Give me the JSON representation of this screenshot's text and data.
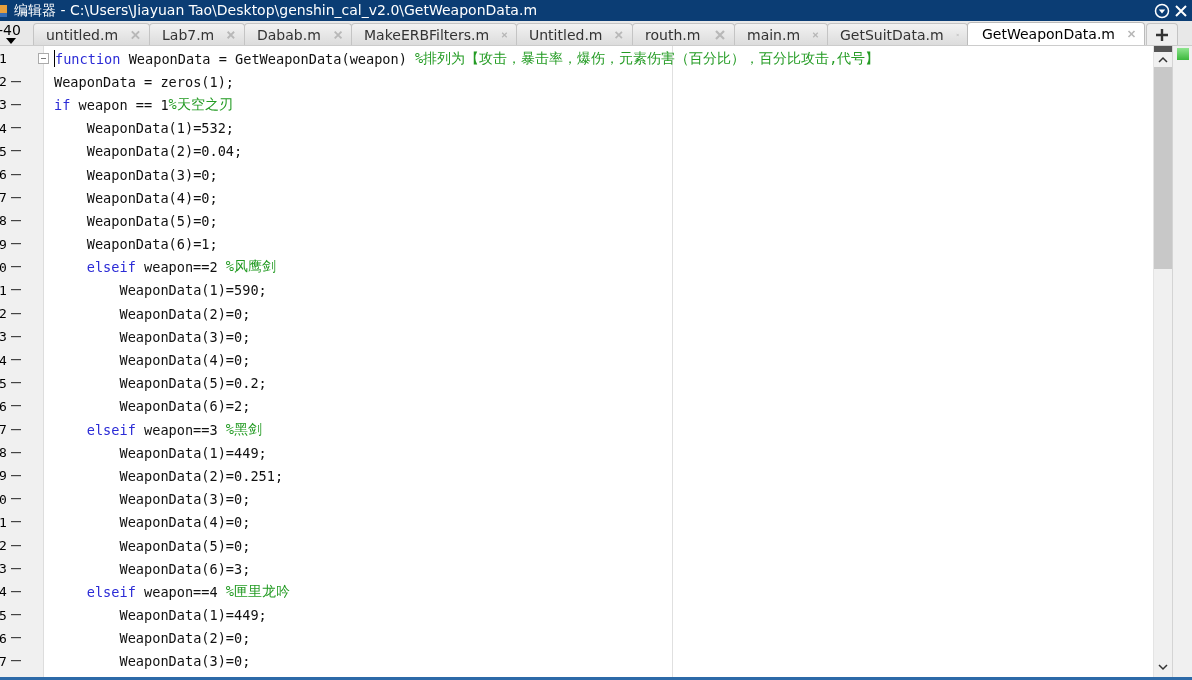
{
  "window": {
    "title": "编辑器 - C:\\Users\\Jiayuan Tao\\Desktop\\genshin_cal_v2.0\\GetWeaponData.m"
  },
  "tab_overflow": {
    "label": "-40"
  },
  "tabs": [
    {
      "label": "untitled.m",
      "selected": false
    },
    {
      "label": "Lab7.m",
      "selected": false
    },
    {
      "label": "Dabab.m",
      "selected": false
    },
    {
      "label": "MakeERBFilters.m",
      "selected": false
    },
    {
      "label": "Untitled.m",
      "selected": false
    },
    {
      "label": "routh.m",
      "selected": false
    },
    {
      "label": "main.m",
      "selected": false
    },
    {
      "label": "GetSuitData.m",
      "selected": false
    },
    {
      "label": "GetWeaponData.m",
      "selected": true
    }
  ],
  "lines": [
    {
      "number": "1",
      "executable": false,
      "foldable": true,
      "tokens": [
        {
          "kind": "keyword",
          "text": "function"
        },
        {
          "kind": "plain",
          "text": "WeaponData = GetWeaponData(weapon)"
        },
        {
          "kind": "comment",
          "text": "%排列为【攻击，暴击率，爆伤，元素伤害（百分比），百分比攻击,代号】"
        }
      ]
    },
    {
      "number": "2",
      "executable": true,
      "foldable": false,
      "tokens": [
        {
          "kind": "plain",
          "text": "WeaponData = zeros(1);"
        }
      ]
    },
    {
      "number": "3",
      "executable": true,
      "foldable": false,
      "tokens": [
        {
          "kind": "keyword",
          "text": "if"
        },
        {
          "kind": "plain",
          "text": "weapon == 1"
        },
        {
          "kind": "comment",
          "text": "%天空之刃"
        }
      ],
      "children": [
        {
          "number": "4",
          "executable": true,
          "foldable": false,
          "tokens": [
            {
              "kind": "plain",
              "text": "WeaponData(1)=532;"
            }
          ]
        },
        {
          "number": "5",
          "executable": true,
          "foldable": false,
          "tokens": [
            {
              "kind": "plain",
              "text": "WeaponData(2)=0.04;"
            }
          ]
        },
        {
          "number": "6",
          "executable": true,
          "foldable": false,
          "tokens": [
            {
              "kind": "plain",
              "text": "WeaponData(3)=0;"
            }
          ]
        },
        {
          "number": "7",
          "executable": true,
          "foldable": false,
          "tokens": [
            {
              "kind": "plain",
              "text": "WeaponData(4)=0;"
            }
          ]
        },
        {
          "number": "8",
          "executable": true,
          "foldable": false,
          "tokens": [
            {
              "kind": "plain",
              "text": "WeaponData(5)=0;"
            }
          ]
        },
        {
          "number": "9",
          "executable": true,
          "foldable": false,
          "tokens": [
            {
              "kind": "plain",
              "text": "WeaponData(6)=1;"
            }
          ]
        },
        {
          "number": "0",
          "executable": true,
          "foldable": false,
          "tokens": [
            {
              "kind": "keyword",
              "text": "elseif"
            },
            {
              "kind": "plain",
              "text": "weapon==2"
            },
            {
              "kind": "comment",
              "text": "%风鹰剑"
            }
          ],
          "children": [
            {
              "number": "1",
              "executable": true,
              "foldable": false,
              "tokens": [
                {
                  "kind": "plain",
                  "text": "WeaponData(1)=590;"
                }
              ]
            },
            {
              "number": "2",
              "executable": true,
              "foldable": false,
              "tokens": [
                {
                  "kind": "plain",
                  "text": "WeaponData(2)=0;"
                }
              ]
            },
            {
              "number": "3",
              "executable": true,
              "foldable": false,
              "tokens": [
                {
                  "kind": "plain",
                  "text": "WeaponData(3)=0;"
                }
              ]
            },
            {
              "number": "4",
              "executable": true,
              "foldable": false,
              "tokens": [
                {
                  "kind": "plain",
                  "text": "WeaponData(4)=0;"
                }
              ]
            },
            {
              "number": "5",
              "executable": true,
              "foldable": false,
              "tokens": [
                {
                  "kind": "plain",
                  "text": "WeaponData(5)=0.2;"
                }
              ]
            },
            {
              "number": "6",
              "executable": true,
              "foldable": false,
              "tokens": [
                {
                  "kind": "plain",
                  "text": "WeaponData(6)=2;"
                }
              ]
            }
          ]
        },
        {
          "number": "7",
          "executable": true,
          "foldable": false,
          "tokens": [
            {
              "kind": "keyword",
              "text": "elseif"
            },
            {
              "kind": "plain",
              "text": "weapon==3"
            },
            {
              "kind": "comment",
              "text": "%黑剑"
            }
          ],
          "children": [
            {
              "number": "8",
              "executable": true,
              "foldable": false,
              "tokens": [
                {
                  "kind": "plain",
                  "text": "WeaponData(1)=449;"
                }
              ]
            },
            {
              "number": "9",
              "executable": true,
              "foldable": false,
              "tokens": [
                {
                  "kind": "plain",
                  "text": "WeaponData(2)=0.251;"
                }
              ]
            },
            {
              "number": "0",
              "executable": true,
              "foldable": false,
              "tokens": [
                {
                  "kind": "plain",
                  "text": "WeaponData(3)=0;"
                }
              ]
            },
            {
              "number": "1",
              "executable": true,
              "foldable": false,
              "tokens": [
                {
                  "kind": "plain",
                  "text": "WeaponData(4)=0;"
                }
              ]
            },
            {
              "number": "2",
              "executable": true,
              "foldable": false,
              "tokens": [
                {
                  "kind": "plain",
                  "text": "WeaponData(5)=0;"
                }
              ]
            },
            {
              "number": "3",
              "executable": true,
              "foldable": false,
              "tokens": [
                {
                  "kind": "plain",
                  "text": "WeaponData(6)=3;"
                }
              ]
            }
          ]
        },
        {
          "number": "4",
          "executable": true,
          "foldable": false,
          "tokens": [
            {
              "kind": "keyword",
              "text": "elseif"
            },
            {
              "kind": "plain",
              "text": "weapon==4"
            },
            {
              "kind": "comment",
              "text": "%匣里龙吟"
            }
          ],
          "children": [
            {
              "number": "5",
              "executable": true,
              "foldable": false,
              "tokens": [
                {
                  "kind": "plain",
                  "text": "WeaponData(1)=449;"
                }
              ]
            },
            {
              "number": "6",
              "executable": true,
              "foldable": false,
              "tokens": [
                {
                  "kind": "plain",
                  "text": "WeaponData(2)=0;"
                }
              ]
            },
            {
              "number": "7",
              "executable": true,
              "foldable": false,
              "tokens": [
                {
                  "kind": "plain",
                  "text": "WeaponData(3)=0;"
                }
              ]
            }
          ]
        }
      ]
    }
  ]
}
